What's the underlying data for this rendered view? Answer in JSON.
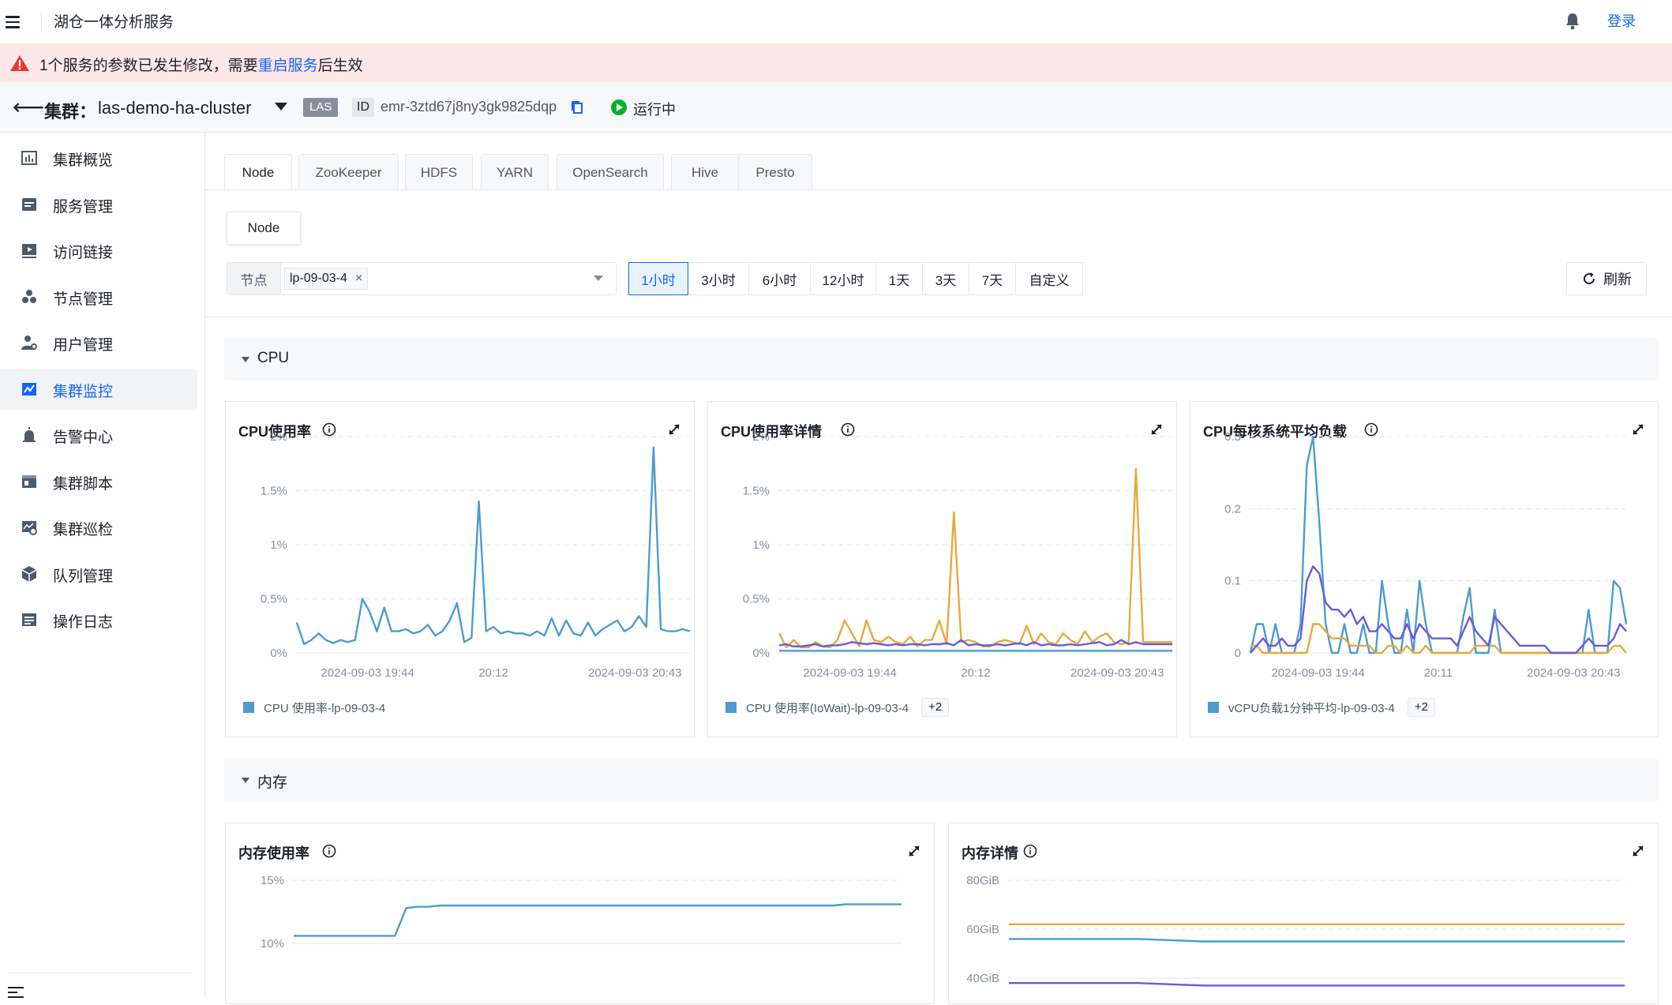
{
  "header": {
    "app_title": "湖仓一体分析服务",
    "login_label": "登录"
  },
  "alert": {
    "prefix": "1个服务的参数已发生修改，需要",
    "link": "重启服务",
    "suffix": "后生效"
  },
  "cluster": {
    "label": "集群：",
    "name": "las-demo-ha-cluster",
    "type_tag": "LAS",
    "id_label": "ID",
    "id_value": "emr-3ztd67j8ny3gk9825dqp",
    "status": "运行中"
  },
  "sidebar": {
    "items": [
      {
        "label": "集群概览",
        "icon": "chart-bar-icon"
      },
      {
        "label": "服务管理",
        "icon": "service-icon"
      },
      {
        "label": "访问链接",
        "icon": "link-play-icon"
      },
      {
        "label": "节点管理",
        "icon": "nodes-icon"
      },
      {
        "label": "用户管理",
        "icon": "user-gear-icon"
      },
      {
        "label": "集群监控",
        "icon": "monitor-chart-icon",
        "active": true
      },
      {
        "label": "告警中心",
        "icon": "alarm-icon"
      },
      {
        "label": "集群脚本",
        "icon": "script-icon"
      },
      {
        "label": "集群巡检",
        "icon": "inspect-icon"
      },
      {
        "label": "队列管理",
        "icon": "cube-icon"
      },
      {
        "label": "操作日志",
        "icon": "log-icon"
      }
    ]
  },
  "tabs": [
    "Node",
    "ZooKeeper",
    "HDFS",
    "YARN",
    "OpenSearch",
    "Hive",
    "Presto"
  ],
  "active_tab": "Node",
  "subtab": "Node",
  "filter": {
    "node_label": "节点",
    "node_value": "lp-09-03-4",
    "ranges": [
      "1小时",
      "3小时",
      "6小时",
      "12小时",
      "1天",
      "3天",
      "7天",
      "自定义"
    ],
    "active_range": "1小时",
    "refresh_label": "刷新"
  },
  "sections": {
    "cpu": "CPU",
    "memory": "内存"
  },
  "colors": {
    "blue": "#4c9bd1",
    "orange": "#e8a93a",
    "purple": "#6a5ad8",
    "accent": "#1664ff"
  },
  "chart_data": [
    {
      "type": "line",
      "title": "CPU使用率",
      "x_ticks": [
        "2024-09-03 19:44",
        "20:12",
        "2024-09-03 20:43"
      ],
      "y_ticks": [
        "0%",
        "0.5%",
        "1%",
        "1.5%",
        "2%"
      ],
      "ylim": [
        0,
        2
      ],
      "series": [
        {
          "name": "CPU 使用率-lp-09-03-4",
          "color": "#4c9bd1",
          "values": [
            0.28,
            0.08,
            0.12,
            0.18,
            0.12,
            0.09,
            0.12,
            0.1,
            0.12,
            0.5,
            0.38,
            0.2,
            0.42,
            0.2,
            0.2,
            0.22,
            0.18,
            0.2,
            0.26,
            0.16,
            0.2,
            0.3,
            0.46,
            0.1,
            0.14,
            1.4,
            0.2,
            0.24,
            0.18,
            0.2,
            0.18,
            0.18,
            0.16,
            0.2,
            0.16,
            0.32,
            0.16,
            0.3,
            0.18,
            0.16,
            0.28,
            0.16,
            0.22,
            0.26,
            0.3,
            0.2,
            0.24,
            0.34,
            0.24,
            1.9,
            0.22,
            0.2,
            0.2,
            0.22,
            0.2
          ]
        }
      ]
    },
    {
      "type": "line",
      "title": "CPU使用率详情",
      "x_ticks": [
        "2024-09-03 19:44",
        "20:12",
        "2024-09-03 20:43"
      ],
      "y_ticks": [
        "0%",
        "0.5%",
        "1%",
        "1.5%",
        "2%"
      ],
      "ylim": [
        0,
        2
      ],
      "legend_more": "+2",
      "series": [
        {
          "name": "CPU 使用率(IoWait)-lp-09-03-4",
          "color": "#4c9bd1",
          "values": [
            0.02,
            0.02,
            0.02,
            0.02,
            0.02,
            0.02,
            0.02,
            0.02,
            0.02,
            0.02,
            0.02,
            0.02,
            0.02,
            0.02,
            0.02,
            0.02,
            0.02,
            0.02,
            0.02,
            0.02,
            0.02,
            0.02,
            0.02,
            0.02,
            0.02,
            0.02,
            0.02,
            0.02,
            0.02,
            0.02,
            0.02,
            0.02,
            0.02,
            0.02,
            0.02,
            0.02,
            0.02,
            0.02,
            0.02,
            0.02,
            0.02,
            0.02,
            0.02,
            0.02,
            0.02,
            0.02,
            0.02,
            0.02,
            0.02,
            0.02,
            0.02,
            0.02,
            0.02,
            0.02,
            0.02
          ]
        },
        {
          "color": "#e8a93a",
          "values": [
            0.18,
            0.05,
            0.12,
            0.05,
            0.05,
            0.1,
            0.06,
            0.05,
            0.12,
            0.3,
            0.18,
            0.06,
            0.3,
            0.12,
            0.1,
            0.15,
            0.1,
            0.08,
            0.15,
            0.06,
            0.12,
            0.12,
            0.3,
            0.08,
            1.3,
            0.1,
            0.12,
            0.1,
            0.06,
            0.06,
            0.1,
            0.12,
            0.1,
            0.08,
            0.25,
            0.08,
            0.18,
            0.1,
            0.08,
            0.18,
            0.12,
            0.08,
            0.2,
            0.1,
            0.15,
            0.18,
            0.1,
            0.08,
            0.1,
            1.7,
            0.1,
            0.1,
            0.1,
            0.1,
            0.1
          ]
        },
        {
          "color": "#6a5ad8",
          "values": [
            0.07,
            0.08,
            0.06,
            0.06,
            0.07,
            0.08,
            0.06,
            0.07,
            0.07,
            0.08,
            0.1,
            0.09,
            0.08,
            0.09,
            0.08,
            0.07,
            0.08,
            0.07,
            0.08,
            0.08,
            0.07,
            0.08,
            0.08,
            0.09,
            0.07,
            0.12,
            0.07,
            0.08,
            0.07,
            0.07,
            0.08,
            0.07,
            0.08,
            0.09,
            0.07,
            0.1,
            0.07,
            0.08,
            0.07,
            0.07,
            0.08,
            0.07,
            0.08,
            0.09,
            0.1,
            0.07,
            0.08,
            0.12,
            0.08,
            0.1,
            0.08,
            0.08,
            0.08,
            0.08,
            0.08
          ]
        }
      ]
    },
    {
      "type": "line",
      "title": "CPU每核系统平均负载",
      "x_ticks": [
        "2024-09-03 19:44",
        "20:11",
        "2024-09-03 20:43"
      ],
      "y_ticks": [
        "0",
        "0.1",
        "0.2",
        "0.3"
      ],
      "ylim": [
        0,
        0.3
      ],
      "legend_more": "+2",
      "series": [
        {
          "name": "vCPU负载1分钟平均-lp-09-03-4",
          "color": "#4c9bd1",
          "values": [
            0,
            0.04,
            0.04,
            0,
            0.04,
            0,
            0,
            0,
            0.04,
            0.26,
            0.3,
            0.18,
            0.04,
            0,
            0,
            0.04,
            0,
            0,
            0.04,
            0,
            0,
            0.1,
            0.04,
            0,
            0,
            0.06,
            0,
            0.1,
            0.04,
            0,
            0,
            0,
            0,
            0,
            0.05,
            0.09,
            0,
            0,
            0,
            0.06,
            0,
            0,
            0,
            0,
            0,
            0,
            0,
            0,
            0,
            0,
            0,
            0,
            0,
            0,
            0.06,
            0,
            0,
            0,
            0.1,
            0.09,
            0.04
          ]
        },
        {
          "color": "#e8a93a",
          "values": [
            0.01,
            0.01,
            0,
            0,
            0,
            0,
            0,
            0,
            0,
            0,
            0.04,
            0.04,
            0.03,
            0.02,
            0.02,
            0.02,
            0.01,
            0.01,
            0.01,
            0.01,
            0,
            0,
            0.01,
            0.01,
            0,
            0.01,
            0,
            0,
            0.01,
            0,
            0,
            0,
            0,
            0,
            0,
            0,
            0.01,
            0.01,
            0.01,
            0.01,
            0,
            0,
            0,
            0,
            0,
            0,
            0,
            0,
            0,
            0,
            0,
            0,
            0,
            0,
            0,
            0,
            0,
            0,
            0.01,
            0.01,
            0
          ]
        },
        {
          "color": "#6a5ad8",
          "values": [
            0,
            0.01,
            0.02,
            0.01,
            0.01,
            0.02,
            0.01,
            0.01,
            0.02,
            0.1,
            0.12,
            0.11,
            0.07,
            0.06,
            0.06,
            0.05,
            0.06,
            0.04,
            0.05,
            0.03,
            0.03,
            0.04,
            0.03,
            0.02,
            0.02,
            0.04,
            0.02,
            0.04,
            0.03,
            0.02,
            0.02,
            0.02,
            0.02,
            0.01,
            0.03,
            0.05,
            0.03,
            0.02,
            0.01,
            0.05,
            0.04,
            0.03,
            0.02,
            0.01,
            0.01,
            0.01,
            0.01,
            0.01,
            0,
            0,
            0,
            0,
            0,
            0.01,
            0.02,
            0.01,
            0.01,
            0.01,
            0.02,
            0.04,
            0.03
          ]
        }
      ]
    },
    {
      "type": "line",
      "title": "内存使用率",
      "y_ticks": [
        "10%",
        "15%"
      ],
      "ylim": [
        10,
        15
      ],
      "series": [
        {
          "color": "#4c9bd1",
          "values": [
            10.6,
            10.6,
            10.6,
            10.6,
            10.6,
            10.6,
            10.6,
            10.6,
            10.6,
            10.6,
            12.8,
            12.9,
            12.9,
            13,
            13,
            13,
            13,
            13,
            13,
            13,
            13,
            13,
            13,
            13,
            13,
            13,
            13,
            13,
            13,
            13,
            13,
            13,
            13,
            13,
            13,
            13,
            13,
            13,
            13,
            13,
            13,
            13,
            13,
            13,
            13,
            13,
            13,
            13,
            13,
            13.1,
            13.1,
            13.1,
            13.1,
            13.1,
            13.1
          ]
        }
      ]
    },
    {
      "type": "line",
      "title": "内存详情",
      "y_ticks": [
        "40GiB",
        "60GiB",
        "80GiB"
      ],
      "ylim": [
        40,
        80
      ],
      "series": [
        {
          "color": "#e8a93a",
          "values": [
            62,
            62,
            62,
            62,
            62,
            62,
            62,
            62,
            62,
            62,
            62,
            62,
            62,
            62,
            62,
            62,
            62,
            62,
            62,
            62
          ]
        },
        {
          "color": "#4c9bd1",
          "values": [
            56,
            56,
            56,
            56,
            56,
            55.5,
            55,
            55,
            55,
            55,
            55,
            55,
            55,
            55,
            55,
            55,
            55,
            55,
            55,
            55
          ]
        },
        {
          "color": "#6a5ad8",
          "values": [
            38,
            38,
            38,
            38,
            38,
            37.5,
            37,
            37,
            37,
            37,
            37,
            37,
            37,
            37,
            37,
            37,
            37,
            37,
            37,
            37
          ]
        }
      ]
    }
  ]
}
